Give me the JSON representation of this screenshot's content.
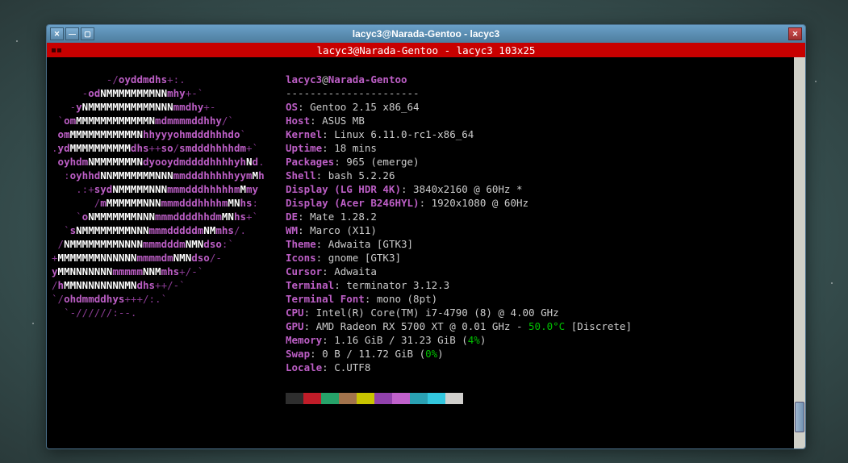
{
  "window": {
    "title": "lacyc3@Narada-Gentoo - lacyc3"
  },
  "terminal_title": "lacyc3@Narada-Gentoo - lacyc3 103x25",
  "user": "lacyc3",
  "host": "Narada-Gentoo",
  "separator": "----------------------",
  "info": {
    "os_label": "OS",
    "os": "Gentoo 2.15 x86_64",
    "host_label": "Host",
    "host": "ASUS MB",
    "kernel_label": "Kernel",
    "kernel": "Linux 6.11.0-rc1-x86_64",
    "uptime_label": "Uptime",
    "uptime": "18 mins",
    "packages_label": "Packages",
    "packages": "965 (emerge)",
    "shell_label": "Shell",
    "shell": "bash 5.2.26",
    "display1_label": "Display (LG HDR 4K)",
    "display1": "3840x2160 @ 60Hz *",
    "display2_label": "Display (Acer B246HYL)",
    "display2": "1920x1080 @ 60Hz",
    "de_label": "DE",
    "de": "Mate 1.28.2",
    "wm_label": "WM",
    "wm": "Marco (X11)",
    "theme_label": "Theme",
    "theme": "Adwaita [GTK3]",
    "icons_label": "Icons",
    "icons": "gnome [GTK3]",
    "cursor_label": "Cursor",
    "cursor": "Adwaita",
    "terminal_label": "Terminal",
    "terminal": "terminator 3.12.3",
    "terminal_font_label": "Terminal Font",
    "terminal_font": "mono (8pt)",
    "cpu_label": "CPU",
    "cpu": "Intel(R) Core(TM) i7-4790 (8) @ 4.00 GHz",
    "gpu_label": "GPU",
    "gpu_pre": "AMD Radeon RX 5700 XT @ 0.01 GHz - ",
    "gpu_temp": "50.0°C",
    "gpu_post": " [Discrete]",
    "memory_label": "Memory",
    "memory_pre": "1.16 GiB / 31.23 GiB (",
    "memory_pct": "4%",
    "memory_post": ")",
    "swap_label": "Swap",
    "swap_pre": "0 B / 11.72 GiB (",
    "swap_pct": "0%",
    "swap_post": ")",
    "locale_label": "Locale",
    "locale": "C.UTF8"
  },
  "logo_lines": [
    "         -/oyddmdhs+:.",
    "     -odNMMMMMMMMNNmhy+-`",
    "   -yNMMMMMMMMMMMNNNmmdhy+-",
    " `omMMMMMMMMMMMMNmdmmmmddhhy/`",
    " omMMMMMMMMMMMNhhyyyohmdddhhhdo`",
    ".ydMMMMMMMMMMdhs++so/smdddhhhhdm+`",
    " oyhdmNMMMMMMMNdyooydmddddhhhhyhNd.",
    "  :oyhhdNNMMMMMMMNNNmmdddhhhhhyymMh",
    "    .:+sydNMMMMMNNNmmmdddhhhhhmMmy",
    "       /mMMMMMMNNNmmmdddhhhhmMNhs:",
    "    `oNMMMMMMMNNNmmmddddhhdmMNhs+`",
    "  `sNMMMMMMMMNNNmmmdddddmNMmhs/.",
    " /NMMMMMMMMNNNNmmmdddmNMNdso:`",
    "+MMMMMMMNNNNNNmmmmdmNMNdso/-",
    "yMMNNNNNNNmmmmmNNMmhs+/-`",
    "/hMMNNNNNNNNMNdhs++/-`",
    "`/ohdmmddhys+++/:.`",
    "  `-//////:--."
  ],
  "palette": [
    "#2e2e2e",
    "#c01c28",
    "#26a269",
    "#a2734c",
    "#c9c400",
    "#9141ac",
    "#c061cb",
    "#2aa1b3",
    "#33c7de",
    "#d0cfcc"
  ]
}
